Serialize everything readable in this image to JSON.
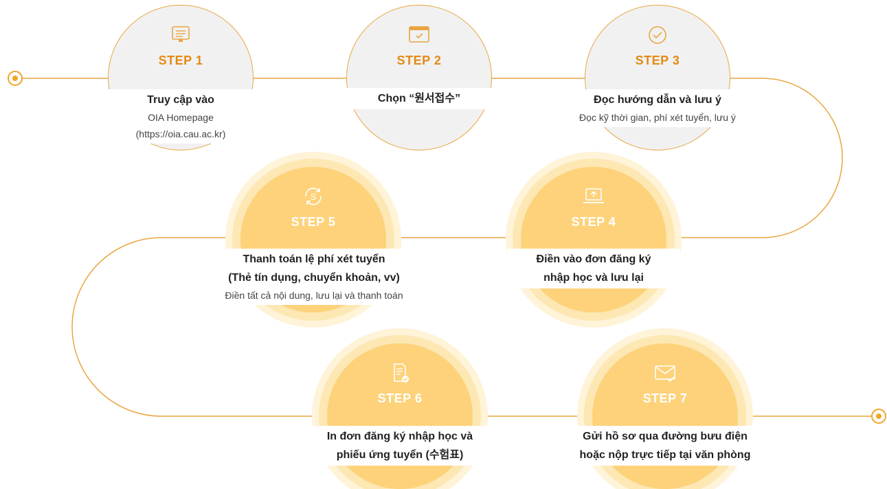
{
  "accent_color": "#f0a52a",
  "steps": [
    {
      "label": "STEP 1",
      "icon": "monitor-list-icon",
      "title": "Truy cập vào",
      "sub": [
        "OIA Homepage",
        "(https://oia.cau.ac.kr)"
      ]
    },
    {
      "label": "STEP 2",
      "icon": "window-check-icon",
      "title": "Chọn “원서접수”",
      "sub": []
    },
    {
      "label": "STEP 3",
      "icon": "check-circle-icon",
      "title": "Đọc hướng dẫn và lưu ý",
      "sub": [
        "Đọc kỹ thời gian, phí xét tuyển, lưu ý"
      ]
    },
    {
      "label": "STEP 4",
      "icon": "laptop-upload-icon",
      "title": [
        "Điền vào đơn đăng ký",
        "nhập học và lưu lại"
      ],
      "sub": []
    },
    {
      "label": "STEP 5",
      "icon": "dollar-refresh-icon",
      "title": [
        "Thanh toán lệ phí xét tuyển",
        "(Thẻ tín dụng, chuyển khoản, vv)"
      ],
      "sub": [
        "Điền tất cả nội dung, lưu lại và thanh toán"
      ]
    },
    {
      "label": "STEP 6",
      "icon": "document-check-icon",
      "title": [
        "In đơn đăng ký nhập học và",
        "phiếu ứng tuyển (수험표)"
      ],
      "sub": []
    },
    {
      "label": "STEP 7",
      "icon": "envelope-check-icon",
      "title": [
        "Gửi hồ sơ qua đường bưu điện",
        "hoặc nộp trực tiếp tại văn phòng"
      ],
      "sub": []
    }
  ]
}
